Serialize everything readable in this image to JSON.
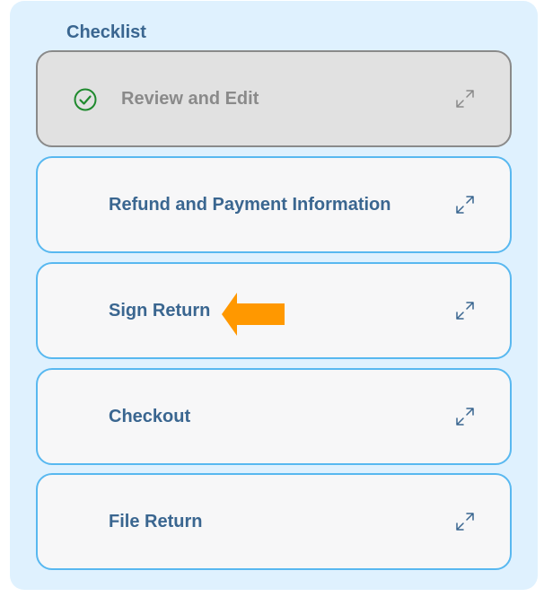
{
  "checklist": {
    "title": "Checklist",
    "items": [
      {
        "label": "Review and Edit",
        "status": "completed",
        "icon": "check-circle-icon"
      },
      {
        "label": "Refund and Payment Information",
        "status": "pending",
        "icon": "expand-icon"
      },
      {
        "label": "Sign Return",
        "status": "pending",
        "icon": "expand-icon"
      },
      {
        "label": "Checkout",
        "status": "pending",
        "icon": "expand-icon"
      },
      {
        "label": "File Return",
        "status": "pending",
        "icon": "expand-icon"
      }
    ],
    "highlight": {
      "icon": "arrow-left-icon",
      "target": "Sign Return",
      "color": "#ff9800"
    },
    "colors": {
      "panel_background": "#dff1fe",
      "card_border": "#58b8f0",
      "text_primary": "#3a6690",
      "completed_text": "#8a8a8a",
      "check_color": "#1f8a2e"
    }
  }
}
